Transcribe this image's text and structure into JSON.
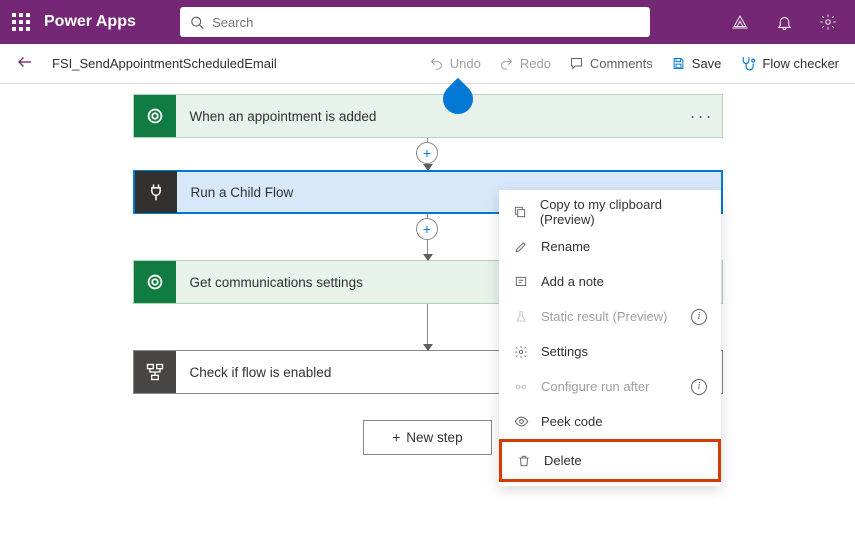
{
  "header": {
    "app_title": "Power Apps",
    "search_placeholder": "Search"
  },
  "commandbar": {
    "flow_name": "FSI_SendAppointmentScheduledEmail",
    "undo": "Undo",
    "redo": "Redo",
    "comments": "Comments",
    "save": "Save",
    "checker": "Flow checker"
  },
  "steps": {
    "s1": "When an appointment is added",
    "s2": "Run a Child Flow",
    "s3": "Get communications settings",
    "s4": "Check if flow is enabled"
  },
  "newstep": "New step",
  "menu": {
    "copy": "Copy to my clipboard (Preview)",
    "rename": "Rename",
    "note": "Add a note",
    "static": "Static result (Preview)",
    "settings": "Settings",
    "runafter": "Configure run after",
    "peek": "Peek code",
    "delete": "Delete"
  }
}
